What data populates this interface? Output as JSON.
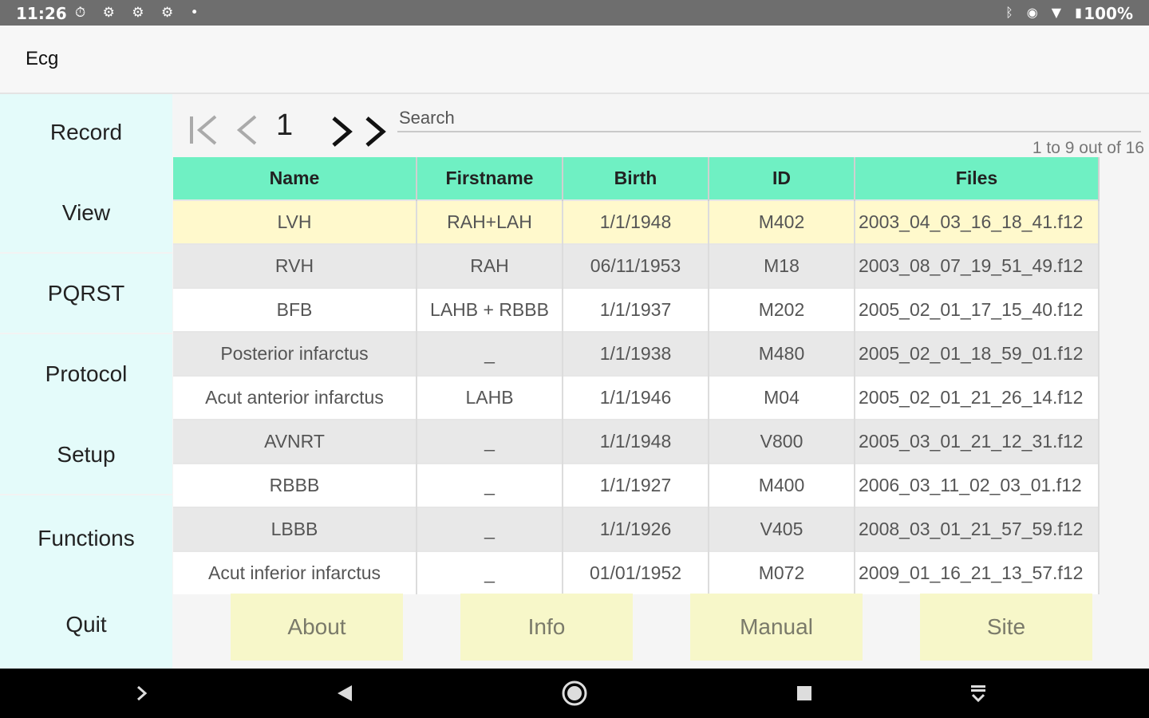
{
  "status_bar": {
    "time": "11:26",
    "left_icons": "⏱ ⚙ ⚙ ⚙ •",
    "right_icons": "ᛒ ◉ ▼ ▮",
    "battery": "100%"
  },
  "app": {
    "title": "Ecg"
  },
  "sidebar": {
    "items": [
      {
        "label": "Record"
      },
      {
        "label": "View"
      },
      {
        "label": "PQRST"
      },
      {
        "label": "Protocol"
      },
      {
        "label": "Setup"
      },
      {
        "label": "Functions"
      },
      {
        "label": "Quit"
      }
    ]
  },
  "pager": {
    "page": "1"
  },
  "search": {
    "placeholder": "Search",
    "value": ""
  },
  "results": {
    "count_text": "1 to 9 out of 16"
  },
  "table": {
    "columns": [
      "Name",
      "Firstname",
      "Birth",
      "ID",
      "Files"
    ],
    "rows": [
      [
        "LVH",
        "RAH+LAH",
        "1/1/1948",
        "M402",
        "2003_04_03_16_18_41.f12"
      ],
      [
        "RVH",
        "RAH",
        "06/11/1953",
        "M18",
        "2003_08_07_19_51_49.f12"
      ],
      [
        "BFB",
        "LAHB + RBBB",
        "1/1/1937",
        "M202",
        "2005_02_01_17_15_40.f12"
      ],
      [
        "Posterior infarctus",
        "_",
        "1/1/1938",
        "M480",
        "2005_02_01_18_59_01.f12"
      ],
      [
        "Acut anterior infarctus",
        "LAHB",
        "1/1/1946",
        "M04",
        "2005_02_01_21_26_14.f12"
      ],
      [
        "AVNRT",
        "_",
        "1/1/1948",
        "V800",
        "2005_03_01_21_12_31.f12"
      ],
      [
        "RBBB",
        "_",
        "1/1/1927",
        "M400",
        "2006_03_11_02_03_01.f12"
      ],
      [
        "LBBB",
        "_",
        "1/1/1926",
        "V405",
        "2008_03_01_21_57_59.f12"
      ],
      [
        "Acut inferior infarctus",
        "_",
        "01/01/1952",
        "M072",
        "2009_01_16_21_13_57.f12"
      ]
    ]
  },
  "buttons": {
    "about": "About",
    "info": "Info",
    "manual": "Manual",
    "site": "Site"
  },
  "navbar": {
    "icons": [
      "chevron-right-icon",
      "back-icon",
      "home-icon",
      "recents-icon",
      "keyboard-hide-icon"
    ]
  },
  "colors": {
    "sidebar_bg": "#e4fbfa",
    "table_header": "#6ff0c3",
    "selected_row": "#fff9cc",
    "button_bg": "#f7f7c9"
  }
}
